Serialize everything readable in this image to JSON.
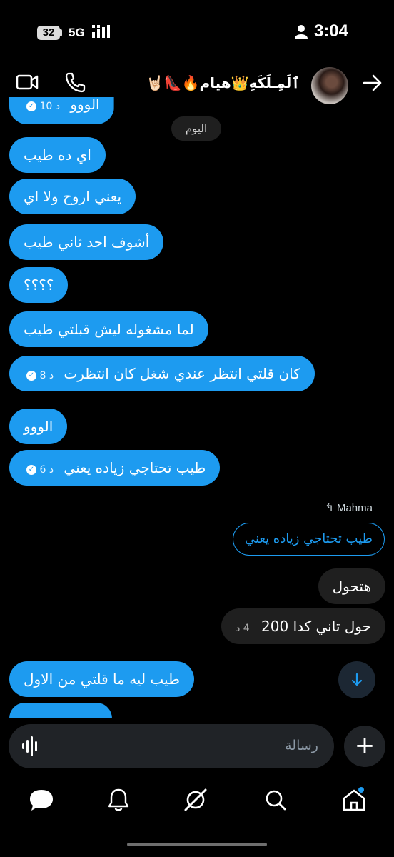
{
  "status_bar": {
    "battery": "32",
    "network": "5G",
    "time": "3:04"
  },
  "header": {
    "title": "ٱلَمِـلَكَهِ👑هيام🔥👠🤘🏻"
  },
  "date_divider": "اليوم",
  "messages_sent_partial": {
    "text": "الووو",
    "time": "10 د"
  },
  "messages": [
    {
      "text": "اي ده طيب"
    },
    {
      "text": "يعني اروح ولا اي"
    },
    {
      "text": "أشوف احد ثاني طيب"
    },
    {
      "text": "؟؟؟؟"
    },
    {
      "text": "لما مشغوله ليش قبلتي طيب"
    },
    {
      "text": "كان قلتي انتظر عندي شغل كان انتظرت",
      "time": "8 د"
    },
    {
      "text": "الووو"
    },
    {
      "text": "طيب تحتاجي زياده يعني",
      "time": "6 د"
    }
  ],
  "reply": {
    "label": "Mahma",
    "quoted": "طيب تحتاجي زياده يعني"
  },
  "received": [
    {
      "text": "هتحول"
    },
    {
      "text": "حول تاني كدا 200",
      "time": "4 د"
    }
  ],
  "last_sent": {
    "text": "طيب ليه ما قلتي من الاول"
  },
  "composer": {
    "placeholder": "رسالة"
  },
  "colors": {
    "accent": "#1d9bf0",
    "background": "#000000",
    "received_bubble": "#1f1f1f"
  },
  "icons": [
    "video-icon",
    "phone-icon",
    "back-arrow-icon",
    "mic-wave-icon",
    "plus-icon",
    "messages-icon",
    "bell-icon",
    "grok-icon",
    "search-icon",
    "home-icon",
    "scroll-down-icon"
  ]
}
